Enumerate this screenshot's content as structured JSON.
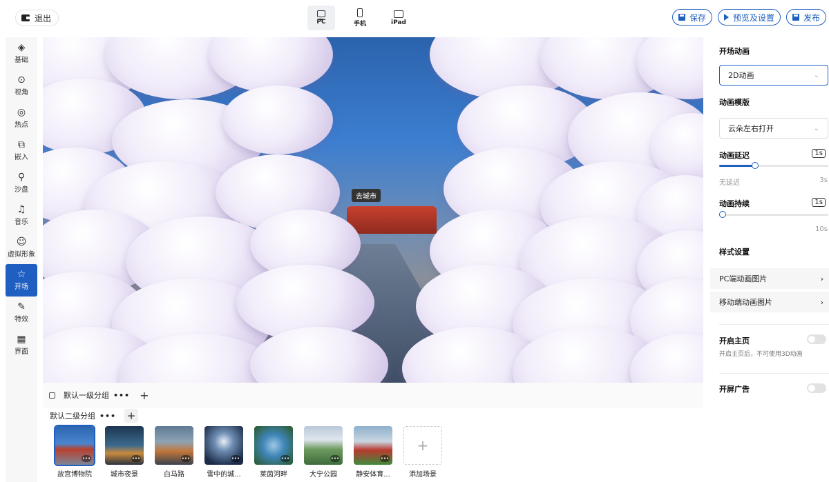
{
  "topbar": {
    "exit_label": "退出",
    "devices": [
      {
        "label": "PC",
        "icon": "monitor-icon",
        "active": true
      },
      {
        "label": "手机",
        "icon": "phone-icon",
        "active": false
      },
      {
        "label": "iPad",
        "icon": "tablet-icon",
        "active": false
      }
    ],
    "save_label": "保存",
    "preview_label": "预览及设置",
    "publish_label": "发布"
  },
  "leftnav": {
    "items": [
      {
        "label": "基础",
        "icon": "layers-icon"
      },
      {
        "label": "视角",
        "icon": "view-icon"
      },
      {
        "label": "热点",
        "icon": "hotspot-icon"
      },
      {
        "label": "嵌入",
        "icon": "embed-icon"
      },
      {
        "label": "沙盘",
        "icon": "sandbox-icon"
      },
      {
        "label": "音乐",
        "icon": "music-icon"
      },
      {
        "label": "虚拟形象",
        "icon": "avatar-icon"
      },
      {
        "label": "开场",
        "icon": "opening-icon",
        "active": true
      },
      {
        "label": "特效",
        "icon": "effects-icon"
      },
      {
        "label": "界面",
        "icon": "interface-icon"
      }
    ]
  },
  "canvas": {
    "hotspot_label": "去城市"
  },
  "scenes": {
    "group1_label": "默认一级分组",
    "group2_label": "默认二级分组",
    "items": [
      {
        "name": "故宫博物院",
        "active": true
      },
      {
        "name": "城市夜景"
      },
      {
        "name": "白马路"
      },
      {
        "name": "雪中的城..."
      },
      {
        "name": "莱茵河畔"
      },
      {
        "name": "大宁公园"
      },
      {
        "name": "静安体育..."
      }
    ],
    "add_label": "添加场景"
  },
  "panel": {
    "opening_animation_title": "开场动画",
    "opening_animation_value": "2D动画",
    "template_title": "动画模版",
    "template_value": "云朵左右打开",
    "delay_title": "动画延迟",
    "delay_value": "1s",
    "delay_level": 0.33,
    "delay_min_label": "无延迟",
    "delay_max_label": "3s",
    "duration_title": "动画持续",
    "duration_value": "1s",
    "duration_level": 0.0,
    "duration_max_label": "10s",
    "style_title": "样式设置",
    "pc_image_label": "PC端动画图片",
    "mobile_image_label": "移动端动画图片",
    "home_title": "开启主页",
    "home_desc": "开启主页后，不可使用3D动画",
    "home_enabled": false,
    "ad_title": "开屏广告",
    "ad_enabled": false
  },
  "colors": {
    "accent": "#1f5fc1"
  }
}
